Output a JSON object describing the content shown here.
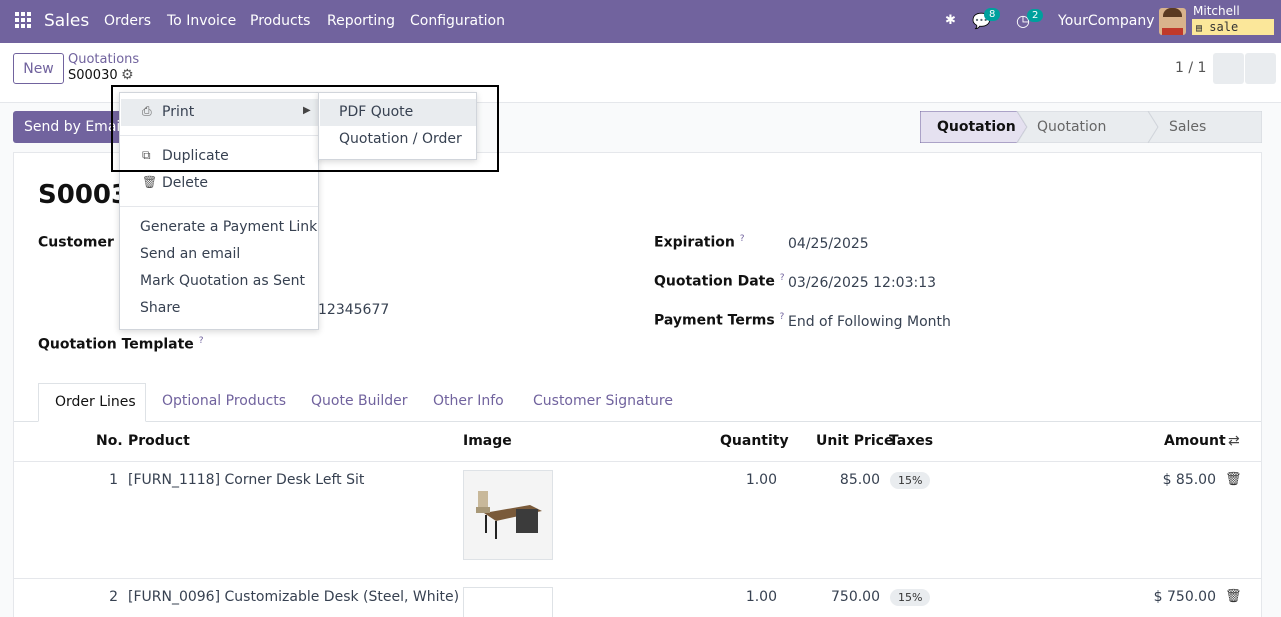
{
  "nav": {
    "brand": "Sales",
    "menu": [
      "Orders",
      "To Invoice",
      "Products",
      "Reporting",
      "Configuration"
    ],
    "chat_count": "8",
    "activity_count": "2",
    "company": "YourCompany",
    "user": "Mitchell Admin",
    "database": "sale"
  },
  "control": {
    "new_label": "New",
    "breadcrumb": "Quotations",
    "record": "S00030",
    "pager": "1 / 1"
  },
  "status": {
    "send_email": "Send by Email",
    "stages": [
      "Quotation",
      "Quotation Sent",
      "Sales Order"
    ]
  },
  "form": {
    "title": "S00030",
    "customer_label": "Customer",
    "customer_phone_partial": "12345677",
    "template_label": "Quotation Template",
    "expiration_label": "Expiration",
    "expiration_value": "04/25/2025",
    "qdate_label": "Quotation Date",
    "qdate_value": "03/26/2025 12:03:13",
    "terms_label": "Payment Terms",
    "terms_value": "End of Following Month"
  },
  "tabs": [
    "Order Lines",
    "Optional Products",
    "Quote Builder",
    "Other Info",
    "Customer Signature"
  ],
  "table": {
    "headers": [
      "No.",
      "Product",
      "Image",
      "Quantity",
      "Unit Price",
      "Taxes",
      "Amount"
    ],
    "rows": [
      {
        "no": "1",
        "product": "[FURN_1118] Corner Desk Left Sit",
        "qty": "1.00",
        "price": "85.00",
        "tax": "15%",
        "amount": "$ 85.00"
      },
      {
        "no": "2",
        "product": "[FURN_0096] Customizable Desk (Steel, White)",
        "qty": "1.00",
        "price": "750.00",
        "tax": "15%",
        "amount": "$ 750.00"
      }
    ]
  },
  "menu": {
    "print": "Print",
    "duplicate": "Duplicate",
    "delete": "Delete",
    "payment_link": "Generate a Payment Link",
    "send_email": "Send an email",
    "mark_sent": "Mark Quotation as Sent",
    "share": "Share"
  },
  "submenu": {
    "pdf_quote": "PDF Quote",
    "quotation_order": "Quotation / Order"
  },
  "colors": {
    "brand": "#71639e",
    "badge": "#00a09d"
  }
}
